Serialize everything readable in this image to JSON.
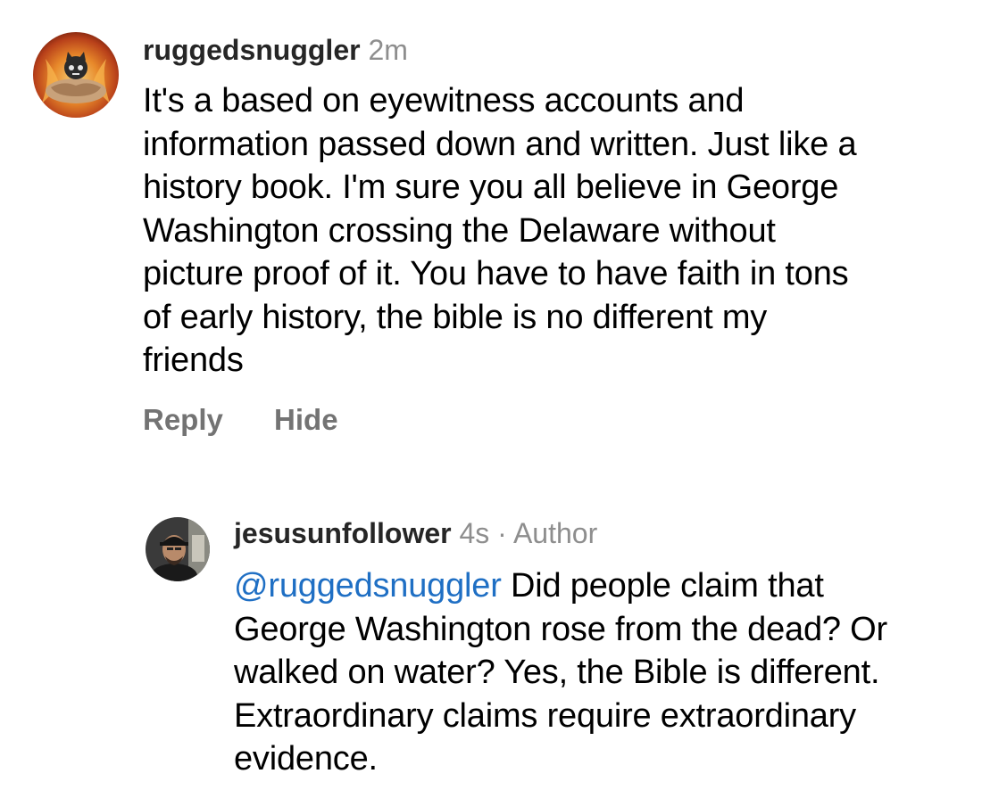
{
  "comments": [
    {
      "username": "ruggedsnuggler",
      "time": "2m",
      "text_lines": [
        "It's a based on eyewitness accounts and",
        "information passed down and written. Just like a",
        "history book. I'm sure you all believe in George",
        "Washington crossing the Delaware without",
        "picture proof of it. You have to have faith in tons",
        "of early history, the bible is no different my",
        "friends"
      ],
      "reply_label": "Reply",
      "hide_label": "Hide"
    },
    {
      "username": "jesusunfollower",
      "time": "4s",
      "separator": "·",
      "role": "Author",
      "mention": "@ruggedsnuggler",
      "text_first_line_rest": " Did people claim that",
      "text_lines": [
        "George Washington rose from the dead? Or",
        "walked on water? Yes, the Bible is different.",
        "Extraordinary claims require extraordinary",
        "evidence."
      ]
    }
  ],
  "colors": {
    "username": "#262626",
    "meta": "#8e8e8e",
    "mention": "#1f6fc4",
    "action": "#737373"
  },
  "icons": {
    "avatar_1": "avatar-fiery-cat-icon",
    "avatar_2": "avatar-man-cap-icon"
  }
}
